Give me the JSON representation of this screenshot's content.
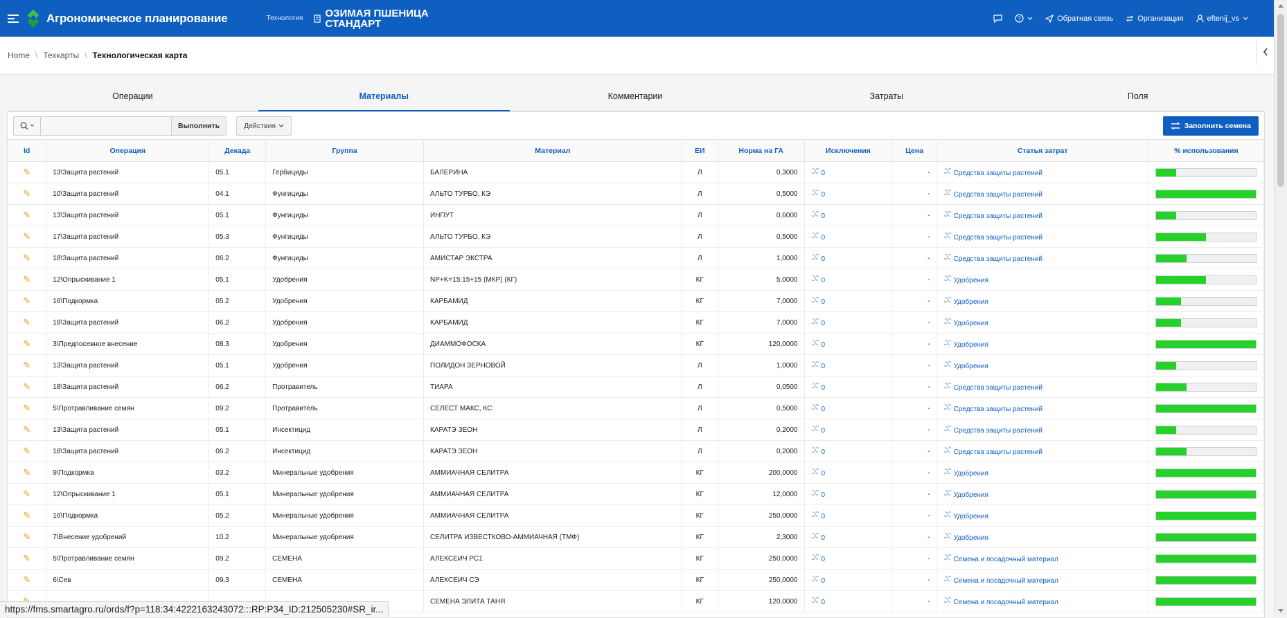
{
  "header": {
    "app_title": "Агрономическое планирование",
    "section": "Технология",
    "document_title_line1": "ОЗИМАЯ ПШЕНИЦА",
    "document_title_line2": "СТАНДАРТ",
    "feedback": "Обратная связь",
    "organization": "Организация",
    "username": "eftenij_vs"
  },
  "breadcrumb": [
    "Home",
    "Техкарты",
    "Технологическая карта"
  ],
  "tabs": [
    "Операции",
    "Материалы",
    "Комментарии",
    "Затраты",
    "Поля"
  ],
  "active_tab": "Материалы",
  "toolbar": {
    "search_placeholder": "",
    "go_label": "Выполнить",
    "actions_label": "Действия",
    "fill_seeds_label": "Заполнить семена"
  },
  "columns": [
    "Id",
    "Операция",
    "Декада",
    "Группа",
    "Материал",
    "ЕИ",
    "Норма на ГА",
    "Исключения",
    "Цена",
    "Статья затрат",
    "% использования"
  ],
  "rows": [
    {
      "op": "13\\Защита растений",
      "dec": "05.1",
      "grp": "Гербициды",
      "mat": "БАЛЕРИНА",
      "unit": "Л",
      "norm": "0,3000",
      "exc": "0",
      "price": "-",
      "cost": "Средства защиты растений",
      "usage": 0.2
    },
    {
      "op": "10\\Защита растений",
      "dec": "04.1",
      "grp": "Фунгициды",
      "mat": "АЛЬТО ТУРБО, КЭ",
      "unit": "Л",
      "norm": "0,5000",
      "exc": "0",
      "price": "-",
      "cost": "Средства защиты растений",
      "usage": 1.0
    },
    {
      "op": "13\\Защита растений",
      "dec": "05.1",
      "grp": "Фунгициды",
      "mat": "ИНПУТ",
      "unit": "Л",
      "norm": "0,6000",
      "exc": "0",
      "price": "-",
      "cost": "Средства защиты растений",
      "usage": 0.2
    },
    {
      "op": "17\\Защита растений",
      "dec": "05.3",
      "grp": "Фунгициды",
      "mat": "АЛЬТО ТУРБО, КЭ",
      "unit": "Л",
      "norm": "0,5000",
      "exc": "0",
      "price": "-",
      "cost": "Средства защиты растений",
      "usage": 0.5
    },
    {
      "op": "18\\Защита растений",
      "dec": "06.2",
      "grp": "Фунгициды",
      "mat": "АМИСТАР ЭКСТРА",
      "unit": "Л",
      "norm": "1,0000",
      "exc": "0",
      "price": "-",
      "cost": "Средства защиты растений",
      "usage": 0.3
    },
    {
      "op": "12\\Опрыскивание 1",
      "dec": "05.1",
      "grp": "Удобрения",
      "mat": "NP+K=15:15+15 (МКР) (КГ)",
      "unit": "КГ",
      "norm": "5,0000",
      "exc": "0",
      "price": "-",
      "cost": "Удобрения",
      "usage": 0.5
    },
    {
      "op": "16\\Подкормка",
      "dec": "05.2",
      "grp": "Удобрения",
      "mat": "КАРБАМИД",
      "unit": "КГ",
      "norm": "7,0000",
      "exc": "0",
      "price": "-",
      "cost": "Удобрения",
      "usage": 0.25
    },
    {
      "op": "18\\Защита растений",
      "dec": "06.2",
      "grp": "Удобрения",
      "mat": "КАРБАМИД",
      "unit": "КГ",
      "norm": "7,0000",
      "exc": "0",
      "price": "-",
      "cost": "Удобрения",
      "usage": 0.25
    },
    {
      "op": "3\\Предпосевное внесение",
      "dec": "08.3",
      "grp": "Удобрения",
      "mat": "ДИАММОФОСКА",
      "unit": "КГ",
      "norm": "120,0000",
      "exc": "0",
      "price": "-",
      "cost": "Удобрения",
      "usage": 1.0
    },
    {
      "op": "13\\Защита растений",
      "dec": "05.1",
      "grp": "Удобрения",
      "mat": "ПОЛИДОН ЗЕРНОВОЙ",
      "unit": "Л",
      "norm": "1,0000",
      "exc": "0",
      "price": "-",
      "cost": "Удобрения",
      "usage": 0.2
    },
    {
      "op": "18\\Защита растений",
      "dec": "06.2",
      "grp": "Протравитель",
      "mat": "ТИАРА",
      "unit": "Л",
      "norm": "0,0500",
      "exc": "0",
      "price": "-",
      "cost": "Средства защиты растений",
      "usage": 0.3
    },
    {
      "op": "5\\Протравливание семян",
      "dec": "09.2",
      "grp": "Протравитель",
      "mat": "СЕЛЕСТ МАКС, КС",
      "unit": "Л",
      "norm": "0,5000",
      "exc": "0",
      "price": "-",
      "cost": "Средства защиты растений",
      "usage": 1.0
    },
    {
      "op": "13\\Защита растений",
      "dec": "05.1",
      "grp": "Инсектицид",
      "mat": "КАРАТЭ ЗЕОН",
      "unit": "Л",
      "norm": "0,2000",
      "exc": "0",
      "price": "-",
      "cost": "Средства защиты растений",
      "usage": 0.2
    },
    {
      "op": "18\\Защита растений",
      "dec": "06.2",
      "grp": "Инсектицид",
      "mat": "КАРАТЭ ЗЕОН",
      "unit": "Л",
      "norm": "0,2000",
      "exc": "0",
      "price": "-",
      "cost": "Средства защиты растений",
      "usage": 0.3
    },
    {
      "op": "9\\Подкормка",
      "dec": "03.2",
      "grp": "Минеральные удобрения",
      "mat": "АММИАЧНАЯ СЕЛИТРА",
      "unit": "КГ",
      "norm": "200,0000",
      "exc": "0",
      "price": "-",
      "cost": "Удобрения",
      "usage": 1.0
    },
    {
      "op": "12\\Опрыскивание 1",
      "dec": "05.1",
      "grp": "Минеральные удобрения",
      "mat": "АММИАЧНАЯ СЕЛИТРА",
      "unit": "КГ",
      "norm": "12,0000",
      "exc": "0",
      "price": "-",
      "cost": "Удобрения",
      "usage": 1.0
    },
    {
      "op": "16\\Подкормка",
      "dec": "05.2",
      "grp": "Минеральные удобрения",
      "mat": "АММИАЧНАЯ СЕЛИТРА",
      "unit": "КГ",
      "norm": "250,0000",
      "exc": "0",
      "price": "-",
      "cost": "Удобрения",
      "usage": 1.0
    },
    {
      "op": "7\\Внесение удобрений",
      "dec": "10.2",
      "grp": "Минеральные удобрения",
      "mat": "СЕЛИТРА ИЗВЕСТКОВО-АММИАЧНАЯ (ТМФ)",
      "unit": "КГ",
      "norm": "2,3000",
      "exc": "0",
      "price": "-",
      "cost": "Удобрения",
      "usage": 1.0
    },
    {
      "op": "5\\Протравливание семян",
      "dec": "09.2",
      "grp": "СЕМЕНА",
      "mat": "АЛЕКСЕИЧ РС1",
      "unit": "КГ",
      "norm": "250,0000",
      "exc": "0",
      "price": "-",
      "cost": "Семена и посадочный материал",
      "usage": 1.0
    },
    {
      "op": "6\\Сев",
      "dec": "09.3",
      "grp": "СЕМЕНА",
      "mat": "АЛЕКСЕИЧ СЭ",
      "unit": "КГ",
      "norm": "250,0000",
      "exc": "0",
      "price": "-",
      "cost": "Семена и посадочный материал",
      "usage": 1.0
    },
    {
      "op": "",
      "dec": "",
      "grp": "",
      "mat": "СЕМЕНА ЭЛИТА ТАНЯ",
      "unit": "КГ",
      "norm": "120,0000",
      "exc": "0",
      "price": "-",
      "cost": "Семена и посадочный материал",
      "usage": 1.0
    }
  ],
  "status_url": "https://fms.smartagro.ru/ords/f?p=118:34:4222163243072:::RP:P34_ID:212505230#SR_ir...",
  "colors": {
    "brand": "#0f5fc1",
    "usage_fill": "#27d12b",
    "edit_icon": "#e8a020"
  }
}
